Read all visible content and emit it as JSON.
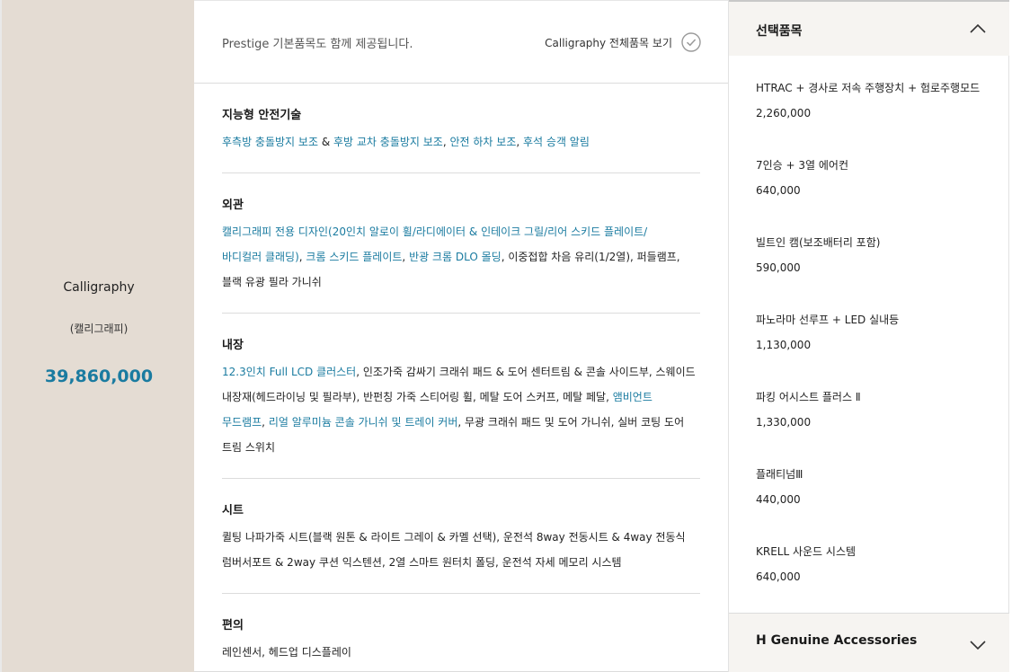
{
  "trim": {
    "name": "Calligraphy",
    "subtitle": "(캘리그래피)",
    "price": "39,860,000"
  },
  "header": {
    "notice": "Prestige 기본품목도 함께 제공됩니다.",
    "view_all": "Calligraphy 전체품목 보기"
  },
  "sections": [
    {
      "title": "지능형 안전기술",
      "segments": [
        {
          "t": "후측방 충돌방지 보조",
          "hl": true
        },
        {
          "t": " & ",
          "hl": false
        },
        {
          "t": "후방 교차 충돌방지 보조",
          "hl": true
        },
        {
          "t": ", ",
          "hl": false
        },
        {
          "t": "안전 하차 보조",
          "hl": true
        },
        {
          "t": ", ",
          "hl": false
        },
        {
          "t": "후석 승객 알림",
          "hl": true
        }
      ]
    },
    {
      "title": "외관",
      "segments": [
        {
          "t": "캘리그래피 전용 디자인(20인치 알로이 휠/라디에이터 & 인테이크 그릴/리어 스키드 플레이트/",
          "hl": true
        },
        {
          "br": true
        },
        {
          "t": "바디컬러 클래딩)",
          "hl": true
        },
        {
          "t": ", ",
          "hl": false
        },
        {
          "t": "크롬 스키드 플레이트",
          "hl": true
        },
        {
          "t": ", ",
          "hl": false
        },
        {
          "t": "반광 크롬 DLO 몰딩",
          "hl": true
        },
        {
          "t": ", 이중접합 차음 유리(1/2열), 퍼들램프,",
          "hl": false
        },
        {
          "br": true
        },
        {
          "t": "블랙 유광 필라 가니쉬",
          "hl": false
        }
      ]
    },
    {
      "title": "내장",
      "segments": [
        {
          "t": "12.3인치 Full LCD 클러스터",
          "hl": true
        },
        {
          "t": ", 인조가죽 감싸기 크래쉬 패드 & 도어 센터트림 & 콘솔 사이드부, 스웨이드",
          "hl": false
        },
        {
          "br": true
        },
        {
          "t": "내장재(헤드라이닝 및 필라부), 반펀칭 가죽 스티어링 휠, 메탈 도어 스커프, 메탈 페달, ",
          "hl": false
        },
        {
          "t": "앰비언트",
          "hl": true
        },
        {
          "br": true
        },
        {
          "t": "무드램프",
          "hl": true
        },
        {
          "t": ", ",
          "hl": false
        },
        {
          "t": "리얼 알루미늄 콘솔 가니쉬 및 트레이 커버",
          "hl": true
        },
        {
          "t": ", 무광 크래쉬 패드 및 도어 가니쉬, 실버 코팅 도어",
          "hl": false
        },
        {
          "br": true
        },
        {
          "t": "트림 스위치",
          "hl": false
        }
      ]
    },
    {
      "title": "시트",
      "segments": [
        {
          "t": "퀼팅 나파가죽 시트(블랙 원톤 & 라이트 그레이 & 카멜 선택), 운전석 8way 전동시트 & 4way 전동식",
          "hl": false
        },
        {
          "br": true
        },
        {
          "t": "럼버서포트 & 2way 쿠션 익스텐션, 2열 스마트 원터치 폴딩, 운전석 자세 메모리 시스템",
          "hl": false
        }
      ]
    },
    {
      "title": "편의",
      "segments": [
        {
          "t": "레인센서, 헤드업 디스플레이",
          "hl": false
        }
      ]
    }
  ],
  "selected": {
    "title": "선택품목",
    "items": [
      {
        "name": "HTRAC + 경사로 저속 주행장치 + 험로주행모드",
        "price": "2,260,000"
      },
      {
        "name": "7인승 + 3열 에어컨",
        "price": "640,000"
      },
      {
        "name": "빌트인 캠(보조배터리 포함)",
        "price": "590,000"
      },
      {
        "name": "파노라마 선루프 + LED 실내등",
        "price": "1,130,000"
      },
      {
        "name": "파킹 어시스트 플러스 Ⅱ",
        "price": "1,330,000"
      },
      {
        "name": "플래티넘Ⅲ",
        "price": "440,000"
      },
      {
        "name": "KRELL 사운드 시스템",
        "price": "640,000"
      }
    ]
  },
  "accessories": {
    "title": "H Genuine Accessories"
  },
  "icons": {
    "check": "check-circle-icon",
    "collapse": "chevron-up-icon",
    "expand": "chevron-down-icon"
  },
  "colors": {
    "accent": "#1a7ba0",
    "trim_bg": "#e4dcd3",
    "panel_bg": "#f6f4f1"
  }
}
